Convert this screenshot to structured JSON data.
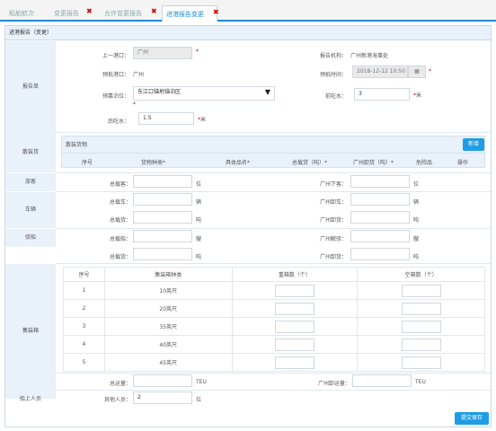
{
  "tabs": [
    {
      "label": "船舶航次",
      "closable": false
    },
    {
      "label": "变更报告",
      "closable": true
    },
    {
      "label": "允许变更报告",
      "closable": true
    },
    {
      "label": "进港报告变更",
      "closable": true,
      "active": true
    }
  ],
  "panel_title": "进港报告（变更）",
  "report": {
    "section": "报告单",
    "prev_port_label": "上一港口：",
    "prev_port_value": "广州",
    "agency_label": "报告机构：",
    "agency_value": "广州新港海事处",
    "dest_port_label": "预抵港口：",
    "dest_port_value": "广州",
    "eta_label": "预抵时间：",
    "eta_value": "2018-12-12 10:50",
    "berth_label": "预靠泊位：",
    "berth_value": "东江口锚地锚泊区",
    "fore_draft_label": "前吃水：",
    "fore_draft_value": "3",
    "fore_draft_unit": "米",
    "aft_draft_label": "后吃水：",
    "aft_draft_value": "1.5",
    "aft_draft_unit": "米"
  },
  "cargo": {
    "section": "散装货",
    "box_title": "散装货物",
    "add_button": "新增",
    "columns": [
      "序号",
      "货物种类*",
      "具体品名*",
      "总载货（吨）*",
      "广州卸货（吨）*",
      "危险品",
      "操作"
    ]
  },
  "passengers": {
    "section": "旅客",
    "total_label": "总载客：",
    "total_unit": "位",
    "local_label": "广州下客：",
    "local_unit": "位"
  },
  "vehicles": {
    "section": "车辆",
    "car_total_label": "总载车：",
    "car_total_unit": "辆",
    "car_local_label": "广州卸车：",
    "car_local_unit": "辆",
    "cargo_total_label": "总载货：",
    "cargo_total_unit": "吨",
    "cargo_local_label": "广州卸货：",
    "cargo_local_unit": "吨"
  },
  "barge": {
    "section": "驳船",
    "ship_total_label": "总载船：",
    "ship_total_unit": "艘",
    "ship_local_label": "广州解驳：",
    "ship_local_unit": "艘",
    "cargo_total_label": "总载货：",
    "cargo_total_unit": "吨",
    "cargo_local_label": "广州卸货：",
    "cargo_local_unit": "吨"
  },
  "container": {
    "section": "集装箱",
    "columns": [
      "序号",
      "集装箱种类",
      "重箱数（个）",
      "空箱数（个）"
    ],
    "rows": [
      {
        "no": "1",
        "type": "10英尺"
      },
      {
        "no": "2",
        "type": "20英尺"
      },
      {
        "no": "3",
        "type": "35英尺"
      },
      {
        "no": "4",
        "type": "40英尺"
      },
      {
        "no": "5",
        "type": "45英尺"
      }
    ],
    "total_label": "总运量：",
    "total_unit": "TEU",
    "local_label": "广州卸运量：",
    "local_unit": "TEU"
  },
  "crew": {
    "section": "船上人员",
    "others_label": "其他人员：",
    "others_value": "2",
    "others_unit": "位"
  },
  "submit_button": "提交保存",
  "colors": {
    "accent": "#1e9de6",
    "required": "#cc0000",
    "section_bg": "#e9f1fa"
  }
}
